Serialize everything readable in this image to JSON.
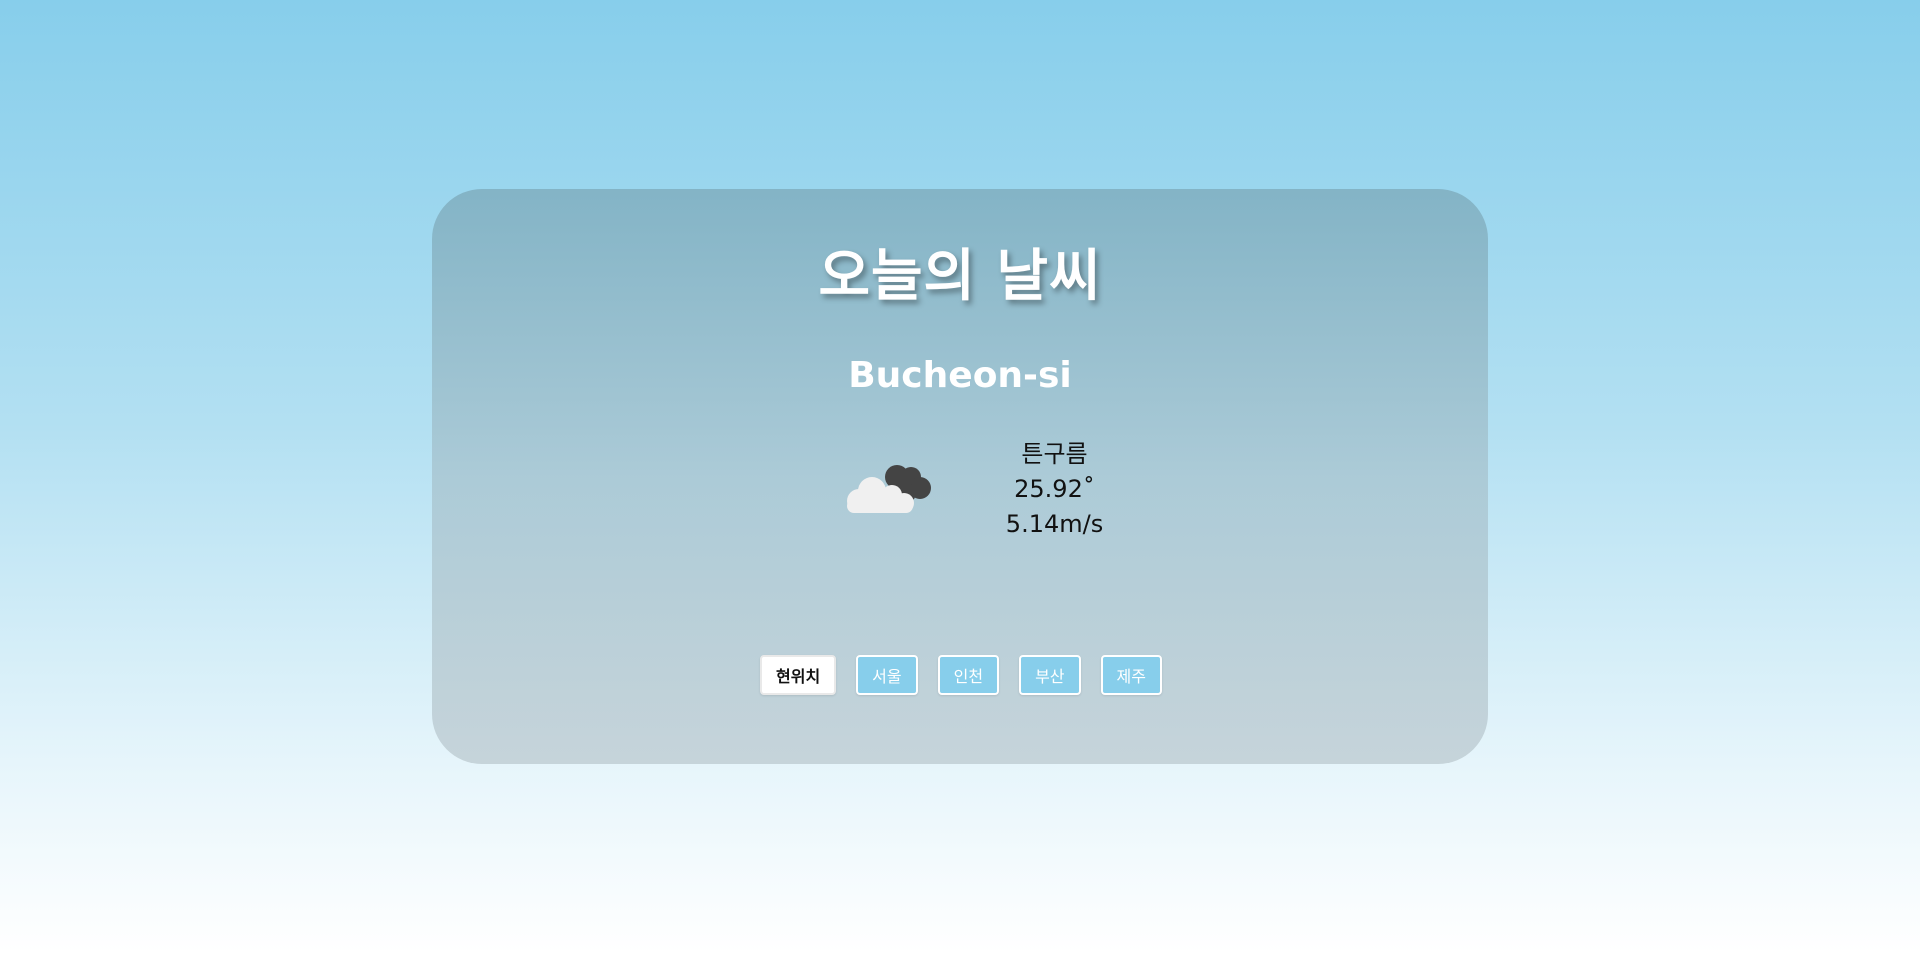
{
  "page": {
    "title": "오늘의 날씨"
  },
  "weather": {
    "city": "Bucheon-si",
    "description": "튼구름",
    "temperature": "25.92˚",
    "wind": "5.14m/s",
    "icon": "broken-clouds-icon"
  },
  "buttons": [
    {
      "label": "현위치",
      "active": true
    },
    {
      "label": "서울",
      "active": false
    },
    {
      "label": "인천",
      "active": false
    },
    {
      "label": "부산",
      "active": false
    },
    {
      "label": "제주",
      "active": false
    }
  ],
  "colors": {
    "accent": "#87ceeb",
    "active_button_bg": "#ffffff",
    "cloud_light": "#f0f0f0",
    "cloud_dark": "#444444"
  }
}
